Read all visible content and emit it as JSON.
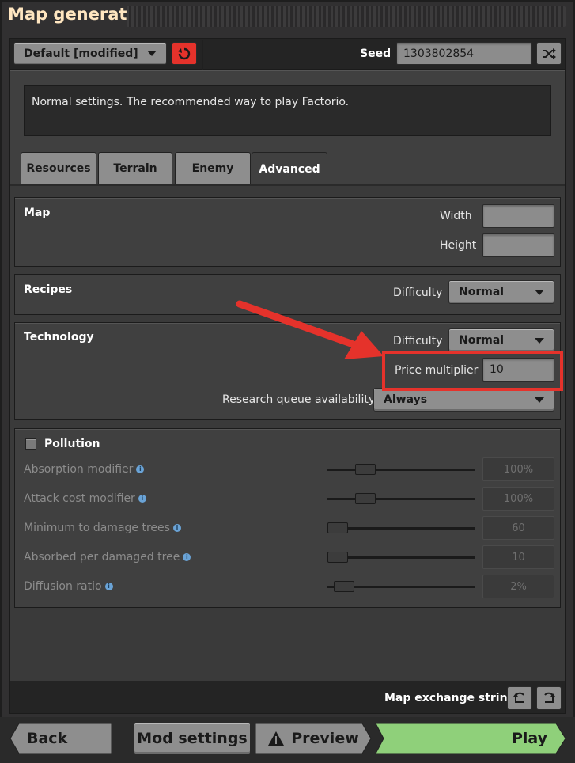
{
  "title": "Map generator",
  "preset": {
    "value": "Default [modified]"
  },
  "seed": {
    "label": "Seed",
    "value": "1303802854"
  },
  "description": "Normal settings. The recommended way to play Factorio.",
  "tabs": [
    "Resources",
    "Terrain",
    "Enemy",
    "Advanced"
  ],
  "map": {
    "header": "Map",
    "width_label": "Width",
    "height_label": "Height",
    "width_value": "",
    "height_value": ""
  },
  "recipes": {
    "header": "Recipes",
    "difficulty_label": "Difficulty",
    "difficulty_value": "Normal"
  },
  "technology": {
    "header": "Technology",
    "difficulty_label": "Difficulty",
    "difficulty_value": "Normal",
    "price_label": "Price multiplier",
    "price_value": "10",
    "queue_label": "Research queue availability",
    "queue_value": "Always"
  },
  "pollution": {
    "header": "Pollution",
    "rows": [
      {
        "label": "Absorption modifier",
        "value": "100%",
        "level": 0.22
      },
      {
        "label": "Attack cost modifier",
        "value": "100%",
        "level": 0.22
      },
      {
        "label": "Minimum to damage trees",
        "value": "60",
        "level": 0.0
      },
      {
        "label": "Absorbed per damaged tree",
        "value": "10",
        "level": 0.0
      },
      {
        "label": "Diffusion ratio",
        "value": "2%",
        "level": 0.05
      }
    ]
  },
  "exchange_label": "Map exchange string",
  "footer": {
    "back": "Back",
    "mod_settings": "Mod settings",
    "preview": "Preview",
    "play": "Play"
  },
  "colors": {
    "accent_red": "#e5322b",
    "play_green": "#8fd07a",
    "title_color": "#ffe6c0"
  },
  "icons": {
    "reset": "reset-icon",
    "shuffle": "shuffle-icon",
    "warning": "warning-icon",
    "import": "import-icon",
    "export": "export-icon",
    "info": "info-icon"
  }
}
